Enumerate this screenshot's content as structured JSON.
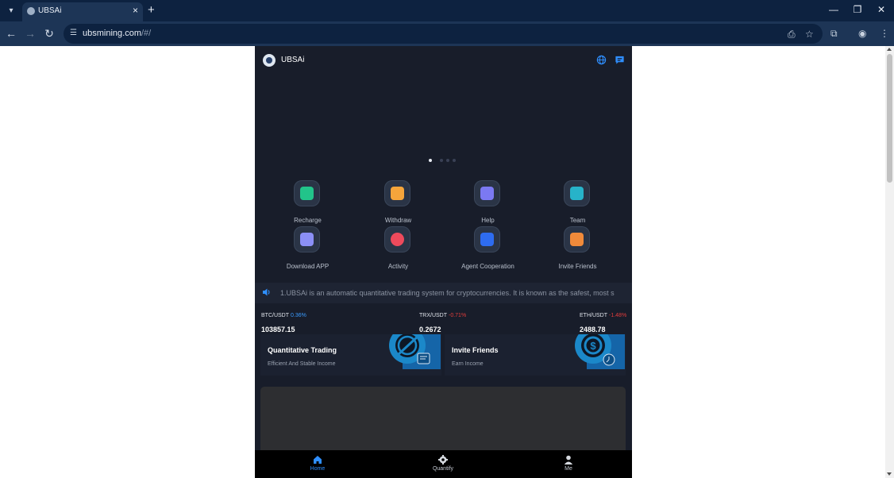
{
  "browser": {
    "tab_title": "UBSAi",
    "url_host": "ubsmining.com",
    "url_path": "/#/",
    "icons": [
      "tab-list-icon",
      "close-icon",
      "plus-icon",
      "minimize-icon",
      "restore-icon",
      "close-window-icon",
      "back-arrow-icon",
      "forward-arrow-icon",
      "reload-icon",
      "site-info-icon",
      "install-app-icon",
      "star-icon",
      "extensions-icon",
      "profile-icon",
      "kebab-menu-icon"
    ]
  },
  "app": {
    "brand": "UBSAi",
    "header_icons": [
      "globe-icon",
      "chat-icon"
    ],
    "carousel": {
      "slide_count": 4,
      "active_index": 0
    },
    "quick_actions": [
      {
        "label": "Recharge",
        "icon": "recharge-icon",
        "color": "#22c48a"
      },
      {
        "label": "Withdraw",
        "icon": "withdraw-icon",
        "color": "#f5a53b"
      },
      {
        "label": "Help",
        "icon": "help-book-icon",
        "color": "#7b79f2"
      },
      {
        "label": "Team",
        "icon": "team-icon",
        "color": "#27b3c9"
      },
      {
        "label": "Download APP",
        "icon": "download-folder-icon",
        "color": "#8b8ff5"
      },
      {
        "label": "Activity",
        "icon": "activity-icon",
        "color": "#ee4a5c"
      },
      {
        "label": "Agent Cooperation",
        "icon": "agent-icon",
        "color": "#2e6cf0"
      },
      {
        "label": "Invite Friends",
        "icon": "invite-envelope-icon",
        "color": "#f08a3a"
      }
    ],
    "notice": "1.UBSAi is an automatic quantitative trading system for cryptocurrencies. It is known as the safest, most s",
    "tickers": [
      {
        "pair": "BTC/USDT",
        "change": "0.36%",
        "direction": "up",
        "price": "103857.15"
      },
      {
        "pair": "TRX/USDT",
        "change": "-0.71%",
        "direction": "down",
        "price": "0.2672"
      },
      {
        "pair": "ETH/USDT",
        "change": "-1.48%",
        "direction": "down",
        "price": "2488.78"
      }
    ],
    "features": [
      {
        "title": "Quantitative Trading",
        "subtitle": "Efficient And Stable Income",
        "icon": "planet-icon"
      },
      {
        "title": "Invite Friends",
        "subtitle": "Earn Income",
        "icon": "coin-clock-icon"
      }
    ],
    "bottom_nav": [
      {
        "label": "Home",
        "icon": "home-icon",
        "active": true
      },
      {
        "label": "Quantify",
        "icon": "gear-icon",
        "active": false
      },
      {
        "label": "Me",
        "icon": "user-icon",
        "active": false
      }
    ],
    "colors": {
      "accent": "#2f8fff",
      "up": "#3b9cff",
      "down": "#e23c3c",
      "background": "#181d2a"
    }
  }
}
